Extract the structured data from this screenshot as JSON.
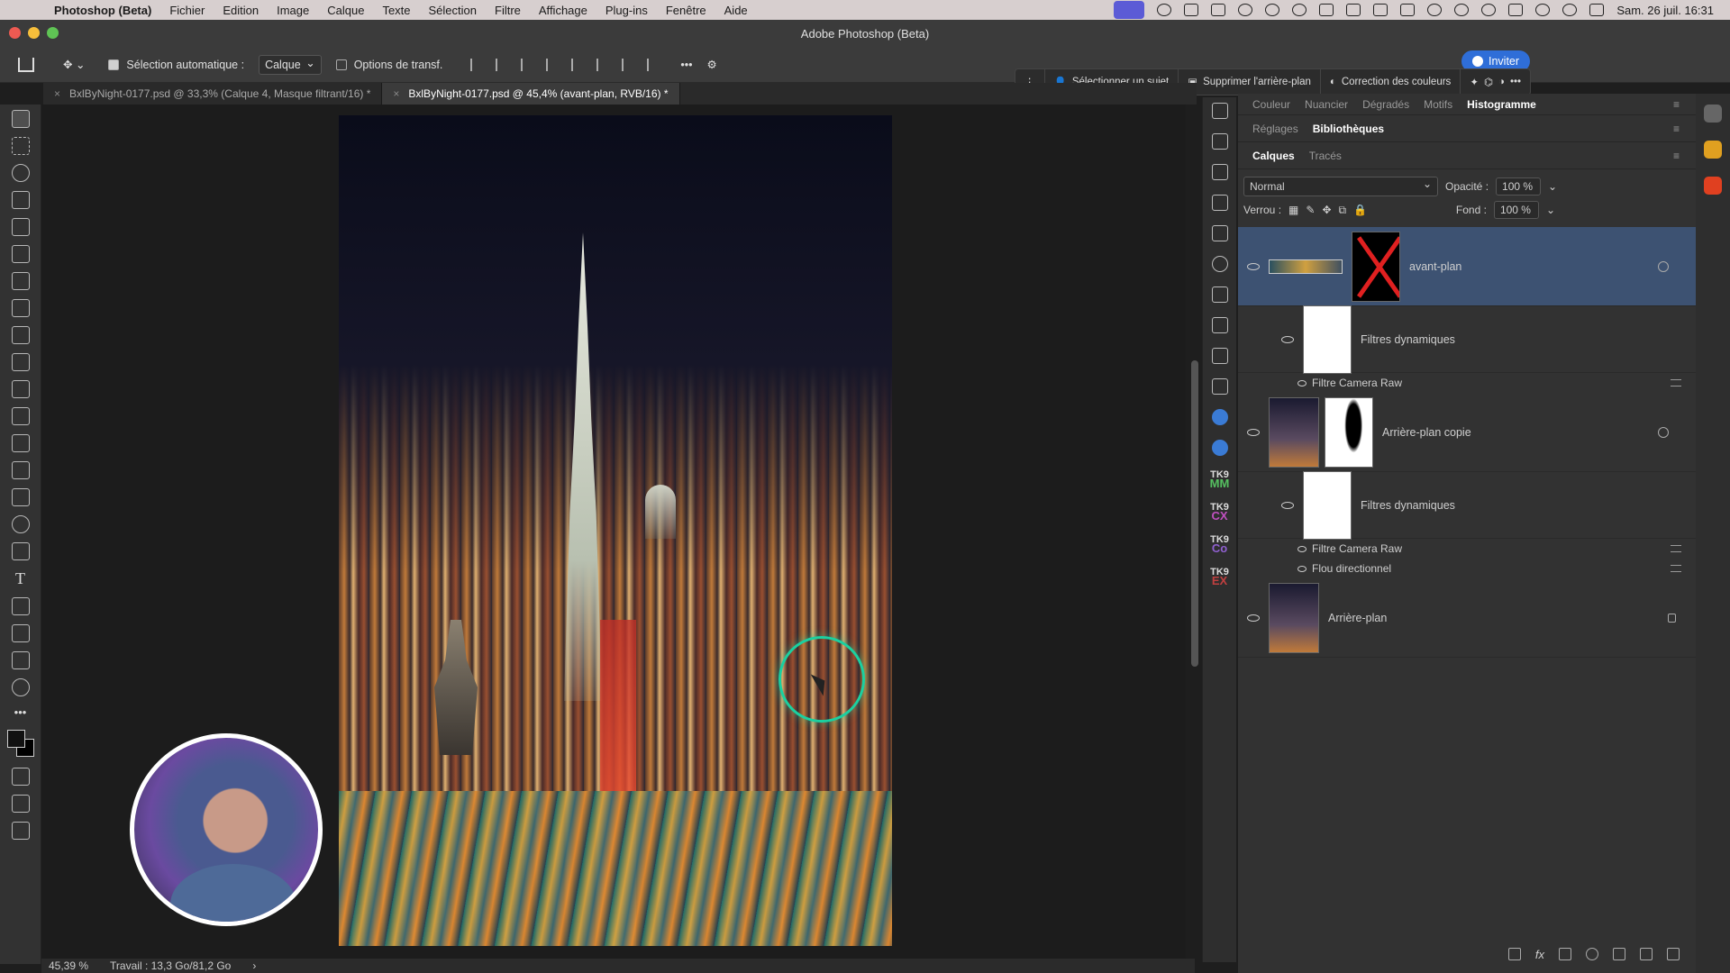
{
  "menubar": {
    "app_name": "Photoshop (Beta)",
    "items": [
      "Fichier",
      "Edition",
      "Image",
      "Calque",
      "Texte",
      "Sélection",
      "Filtre",
      "Affichage",
      "Plug-ins",
      "Fenêtre",
      "Aide"
    ],
    "clock": "Sam. 26 juil.  16:31"
  },
  "window": {
    "title": "Adobe Photoshop (Beta)"
  },
  "options": {
    "auto_select_label": "Sélection automatique :",
    "auto_select_value": "Calque",
    "transform_options_label": "Options de transf.",
    "more": "•••"
  },
  "context_bar": {
    "select_subject": "Sélectionner un sujet",
    "remove_background": "Supprimer l'arrière-plan",
    "color_correction": "Correction des couleurs"
  },
  "invite_label": "Inviter",
  "tabs": [
    {
      "label": "BxlByNight-0177.psd @ 33,3% (Calque 4, Masque filtrant/16) *"
    },
    {
      "label": "BxlByNight-0177.psd @ 45,4% (avant-plan, RVB/16) *"
    }
  ],
  "status": {
    "zoom": "45,39 %",
    "work": "Travail : 13,3 Go/81,2 Go",
    "arrow": "›"
  },
  "panels": {
    "top_tabs": [
      "Couleur",
      "Nuancier",
      "Dégradés",
      "Motifs",
      "Histogramme"
    ],
    "mid_tabs": [
      "Réglages",
      "Bibliothèques"
    ],
    "layer_tabs": [
      "Calques",
      "Tracés"
    ],
    "blend_mode": "Normal",
    "opacity_label": "Opacité :",
    "opacity": "100 %",
    "lock_label": "Verrou :",
    "fill_label": "Fond :",
    "fill": "100 %",
    "layers": {
      "l1": "avant-plan",
      "l1_sub": "Filtres dynamiques",
      "l1_filter": "Filtre Camera Raw",
      "l2": "Arrière-plan copie",
      "l2_sub": "Filtres dynamiques",
      "l2_filter1": "Filtre Camera Raw",
      "l2_filter2": "Flou directionnel",
      "l3": "Arrière-plan"
    }
  },
  "toolbar_icons": [
    "move-tool",
    "marquee-tool",
    "lasso-tool",
    "object-select-tool",
    "crop-tool",
    "frame-tool",
    "eyedropper-tool",
    "healing-tool",
    "brush-tool",
    "stamp-tool",
    "history-brush-tool",
    "eraser-tool",
    "gradient-tool",
    "smudge-tool",
    "dodge-tool",
    "burn-tool",
    "pen-tool",
    "type-tool",
    "path-select-tool",
    "rectangle-tool",
    "hand-tool",
    "zoom-tool",
    "more-tools"
  ],
  "plugins": [
    "TK9 MM",
    "TK9 CX",
    "TK9 CO",
    "TK9 EX"
  ],
  "colors": {
    "accent": "#2f6ed8",
    "selected_layer": "#3d5272",
    "cursor_ring": "#1bd0a0"
  }
}
